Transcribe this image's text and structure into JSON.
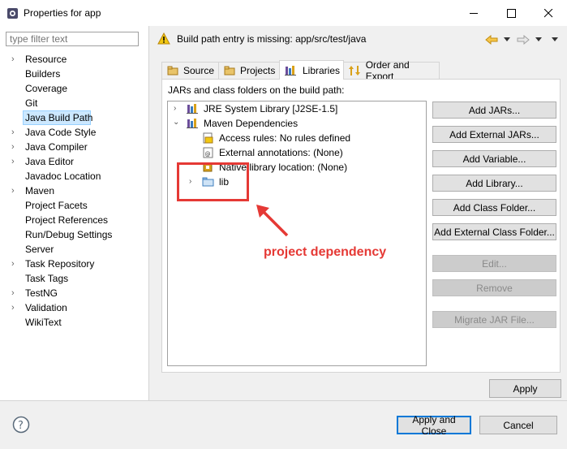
{
  "window": {
    "title": "Properties for app",
    "minimize_icon": "minimize-icon",
    "maximize_icon": "maximize-icon",
    "close_icon": "close-icon"
  },
  "filter": {
    "placeholder": "type filter text"
  },
  "nav": {
    "items": [
      {
        "label": "Resource",
        "expandable": true
      },
      {
        "label": "Builders",
        "expandable": false
      },
      {
        "label": "Coverage",
        "expandable": false
      },
      {
        "label": "Git",
        "expandable": false
      },
      {
        "label": "Java Build Path",
        "expandable": false,
        "selected": true
      },
      {
        "label": "Java Code Style",
        "expandable": true
      },
      {
        "label": "Java Compiler",
        "expandable": true
      },
      {
        "label": "Java Editor",
        "expandable": true
      },
      {
        "label": "Javadoc Location",
        "expandable": false
      },
      {
        "label": "Maven",
        "expandable": true
      },
      {
        "label": "Project Facets",
        "expandable": false
      },
      {
        "label": "Project References",
        "expandable": false
      },
      {
        "label": "Run/Debug Settings",
        "expandable": false
      },
      {
        "label": "Server",
        "expandable": false
      },
      {
        "label": "Task Repository",
        "expandable": true
      },
      {
        "label": "Task Tags",
        "expandable": false
      },
      {
        "label": "TestNG",
        "expandable": true
      },
      {
        "label": "Validation",
        "expandable": true
      },
      {
        "label": "WikiText",
        "expandable": false
      }
    ]
  },
  "header": {
    "warning": "Build path entry is missing: app/src/test/java"
  },
  "tabs": [
    "Source",
    "Projects",
    "Libraries",
    "Order and Export"
  ],
  "active_tab": "Libraries",
  "panel": {
    "label": "JARs and class folders on the build path:",
    "tree": [
      {
        "label": "JRE System Library [J2SE-1.5]"
      },
      {
        "label": "Maven Dependencies"
      },
      {
        "label": "Access rules: No rules defined"
      },
      {
        "label": "External annotations: (None)"
      },
      {
        "label": "Native library location: (None)"
      },
      {
        "label": "lib"
      }
    ]
  },
  "buttons": {
    "add_jars": "Add JARs...",
    "add_external_jars": "Add External JARs...",
    "add_variable": "Add Variable...",
    "add_library": "Add Library...",
    "add_class_folder": "Add Class Folder...",
    "add_external_class_folder": "Add External Class Folder...",
    "edit": "Edit...",
    "remove": "Remove",
    "migrate_jar": "Migrate JAR File...",
    "apply": "Apply",
    "apply_and_close": "Apply and Close",
    "cancel": "Cancel"
  },
  "annotation": {
    "text": "project dependency"
  },
  "colors": {
    "accent": "#0078d7",
    "annotation": "#e53935",
    "selection": "#cce8ff"
  }
}
